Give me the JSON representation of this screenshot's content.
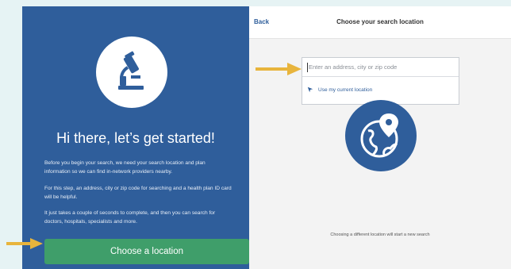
{
  "left": {
    "greeting": "Hi there, let’s get started!",
    "paragraphs": [
      "Before you begin your search, we need your search location and plan information so we can find in-network providers nearby.",
      "For this step, an address, city or zip code for searching and a health plan ID card will be helpful.",
      "It just takes a couple of seconds to complete, and then you can search for doctors, hospitals, specialists and more."
    ],
    "button_label": "Choose a location",
    "icon": "microscope-icon"
  },
  "right": {
    "back_label": "Back",
    "title": "Choose your search location",
    "search_placeholder": "Enter an address, city or zip code",
    "use_location_label": "Use my current location",
    "footnote": "Choosing a different location will start a new search",
    "icon": "globe-pin-icon"
  },
  "colors": {
    "panel_blue": "#2f5e9b",
    "button_green": "#3f9e6a",
    "arrow_gold": "#e8b43c",
    "background": "#e6f3f4"
  }
}
